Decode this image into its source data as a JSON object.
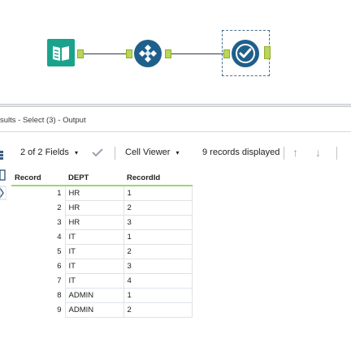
{
  "workflow": {
    "tools": [
      {
        "name": "Input Data",
        "icon": "book-icon",
        "color": "#1aa38c"
      },
      {
        "name": "Multi-Field",
        "icon": "sparkle-diamond-icon",
        "color": "#1f5f8b"
      },
      {
        "name": "Select",
        "icon": "check-circle-icon",
        "color": "#1f5f8b"
      }
    ],
    "anchor_color": "#b9d55a",
    "connection_color": "#2e3a46"
  },
  "results": {
    "title": "sults - Select (3) - Output",
    "fields_label": "2 of 2 Fields",
    "cell_viewer_label": "Cell Viewer",
    "records_label": "9 records displayed",
    "columns": [
      "Record",
      "DEPT",
      "RecordId"
    ],
    "rows": [
      {
        "record": "1",
        "dept": "HR",
        "recordid": "1"
      },
      {
        "record": "2",
        "dept": "HR",
        "recordid": "2"
      },
      {
        "record": "3",
        "dept": "HR",
        "recordid": "3"
      },
      {
        "record": "4",
        "dept": "IT",
        "recordid": "1"
      },
      {
        "record": "5",
        "dept": "IT",
        "recordid": "2"
      },
      {
        "record": "6",
        "dept": "IT",
        "recordid": "3"
      },
      {
        "record": "7",
        "dept": "IT",
        "recordid": "4"
      },
      {
        "record": "8",
        "dept": "ADMIN",
        "recordid": "1"
      },
      {
        "record": "9",
        "dept": "ADMIN",
        "recordid": "2"
      }
    ],
    "header_underline_color": "#9fd66f"
  }
}
